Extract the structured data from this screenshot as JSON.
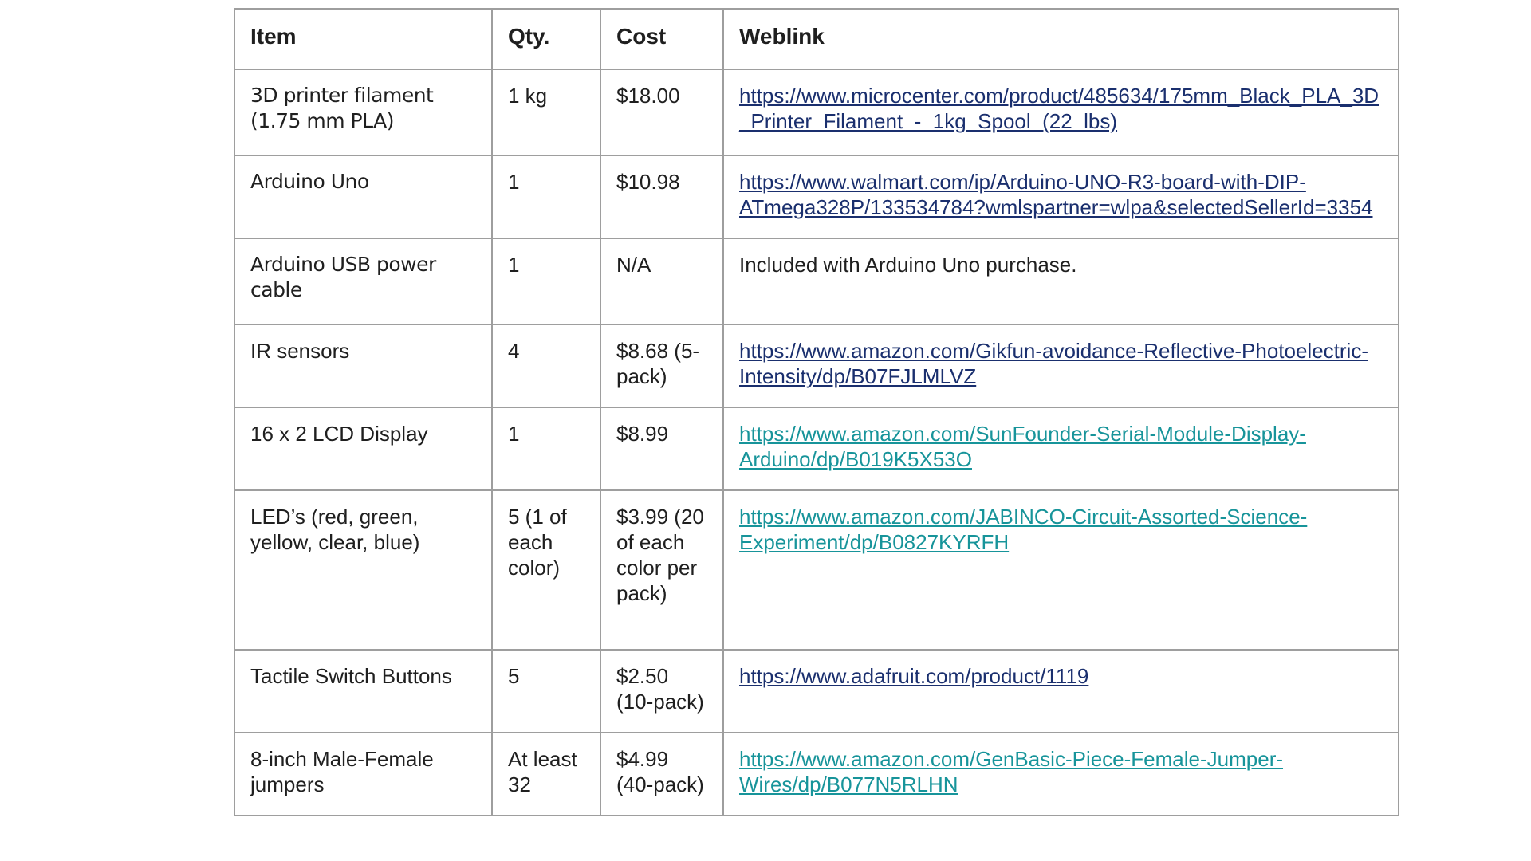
{
  "table": {
    "headers": {
      "item": "Item",
      "qty": "Qty.",
      "cost": "Cost",
      "weblink": "Weblink"
    },
    "rows": [
      {
        "item": "3D printer filament (1.75 mm PLA)",
        "qty": "1 kg",
        "cost": "$18.00",
        "weblink": "https://www.microcenter.com/product/485634/175mm_Black_PLA_3D_Printer_Filament_-_1kg_Spool_(22_lbs)",
        "link_color": "#1a2f6e"
      },
      {
        "item": "Arduino Uno",
        "qty": "1",
        "cost": "$10.98",
        "weblink": "https://www.walmart.com/ip/Arduino-UNO-R3-board-with-DIP-ATmega328P/133534784?wmlspartner=wlpa&selectedSellerId=3354",
        "link_color": "#1a2f6e"
      },
      {
        "item": "Arduino USB power cable",
        "qty": "1",
        "cost": "N/A",
        "weblink_text": "Included with Arduino Uno purchase."
      },
      {
        "item": "IR sensors",
        "qty": "4",
        "cost": "$8.68 (5-pack)",
        "weblink": "https://www.amazon.com/Gikfun-avoidance-Reflective-Photoelectric-Intensity/dp/B07FJLMLVZ",
        "link_color": "#1a2f6e"
      },
      {
        "item": "16 x 2 LCD Display",
        "qty": "1",
        "cost": "$8.99",
        "weblink": "https://www.amazon.com/SunFounder-Serial-Module-Display-Arduino/dp/B019K5X53O",
        "link_color": "#17949a"
      },
      {
        "item": "LED’s (red, green, yellow, clear, blue)",
        "qty": "5 (1 of each color)",
        "cost": "$3.99 (20 of each color per pack)",
        "weblink": "https://www.amazon.com/JABINCO-Circuit-Assorted-Science-Experiment/dp/B0827KYRFH",
        "link_color": "#17949a"
      },
      {
        "item": "Tactile Switch Buttons",
        "qty": "5",
        "cost": "$2.50 (10-pack)",
        "weblink": "https://www.adafruit.com/product/1119",
        "link_color": "#1a2f6e"
      },
      {
        "item": "8-inch Male-Female jumpers",
        "qty": "At least 32",
        "cost": "$4.99 (40-pack)",
        "weblink": "https://www.amazon.com/GenBasic-Piece-Female-Jumper-Wires/dp/B077N5RLHN",
        "link_color": "#17949a"
      }
    ]
  }
}
